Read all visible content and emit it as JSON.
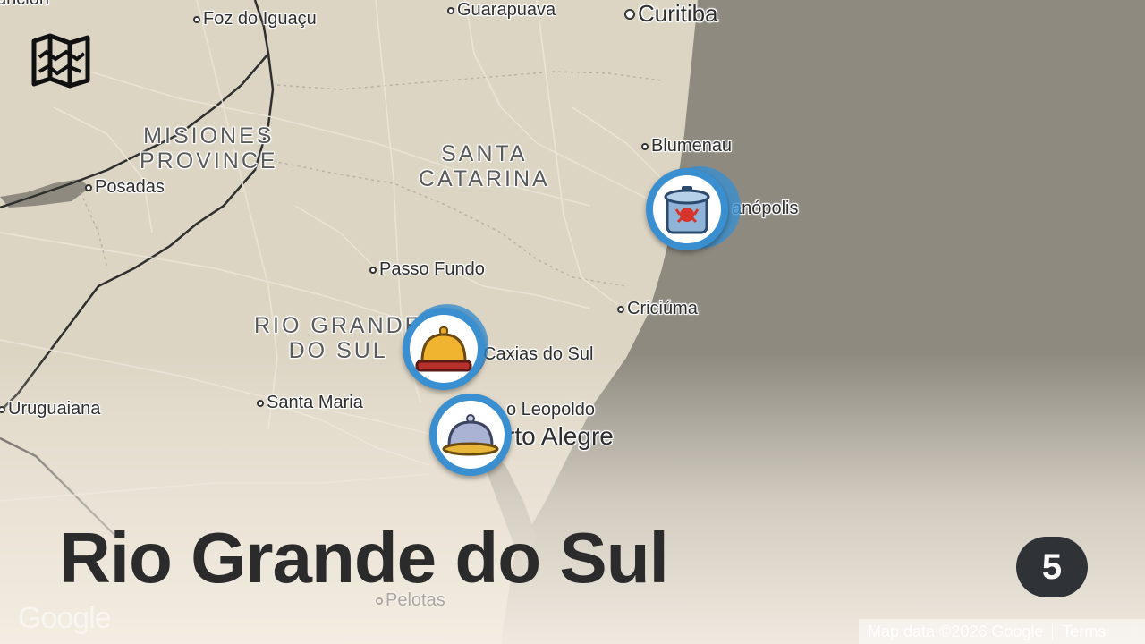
{
  "cities": {
    "foz": "Foz do Iguaçu",
    "guarapuava": "Guarapuava",
    "curitiba": "Curitiba",
    "blumenau": "Blumenau",
    "florianopolis": "anópolis",
    "posadas": "Posadas",
    "passo_fundo": "Passo Fundo",
    "criciuma": "Criciúma",
    "caxias": "Caxias do Sul",
    "santa_maria": "Santa Maria",
    "uruguaiana": "Uruguaiana",
    "sao_leopoldo": "o Leopoldo",
    "porto_alegre": "rto Alegre",
    "pelotas": "Pelotas",
    "asuncion": "unción"
  },
  "regions": {
    "misiones": [
      "MISIONES",
      "PROVINCE"
    ],
    "santa_catarina": [
      "SANTA",
      "CATARINA"
    ],
    "rio_grande": [
      "RIO GRANDE",
      "DO SUL"
    ]
  },
  "markers": [
    {
      "name": "crab-pot-marker",
      "icon": "crab-pot-icon"
    },
    {
      "name": "service-bell-marker",
      "icon": "service-bell-icon"
    },
    {
      "name": "cloche-marker",
      "icon": "cloche-icon"
    }
  ],
  "overlay": {
    "title": "Rio Grande do Sul",
    "count": "5"
  },
  "attribution": {
    "logo": "Google",
    "map_data": "Map data ©2026 Google",
    "terms": "Terms"
  },
  "colors": {
    "land": "#ddd5c4",
    "ocean": "#8e8a80",
    "marker_ring": "#3a8fd0",
    "badge": "#2f3337"
  }
}
